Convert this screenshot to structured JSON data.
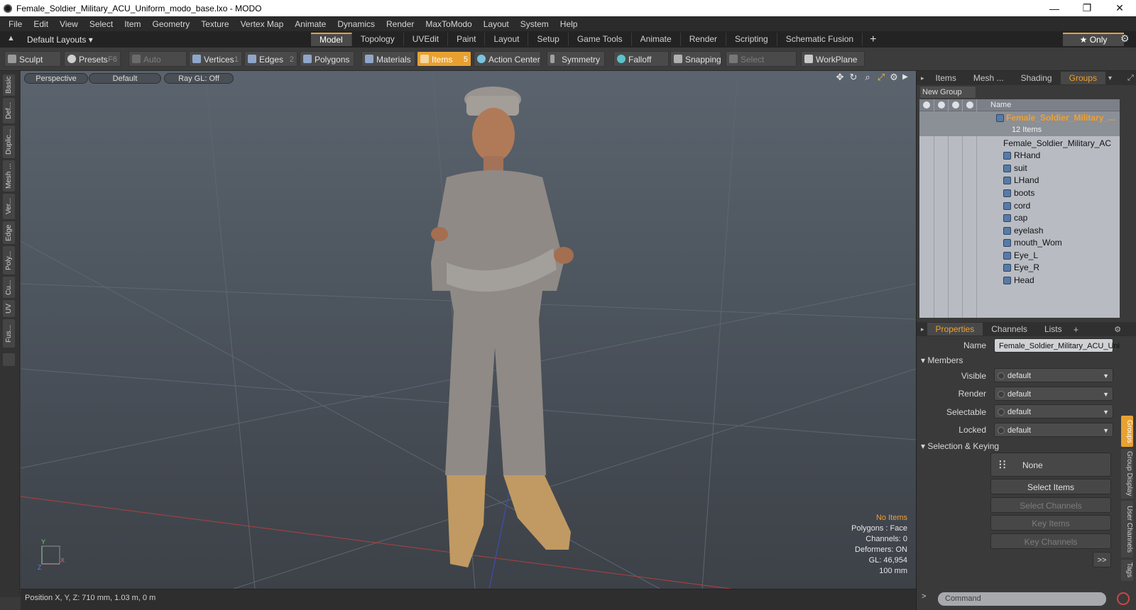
{
  "window": {
    "title": "Female_Soldier_Military_ACU_Uniform_modo_base.lxo - MODO",
    "minimize": "—",
    "maximize": "❐",
    "close": "✕"
  },
  "menu": [
    "File",
    "Edit",
    "View",
    "Select",
    "Item",
    "Geometry",
    "Texture",
    "Vertex Map",
    "Animate",
    "Dynamics",
    "Render",
    "MaxToModo",
    "Layout",
    "System",
    "Help"
  ],
  "layout_tabs": {
    "layouts_label": "Default Layouts ▾",
    "tabs": [
      "Model",
      "Topology",
      "UVEdit",
      "Paint",
      "Layout",
      "Setup",
      "Game Tools",
      "Animate",
      "Render",
      "Scripting",
      "Schematic Fusion"
    ],
    "active": "Model",
    "only_label": "★  Only"
  },
  "toolbar": {
    "sculpt": "Sculpt",
    "presets": "Presets",
    "presets_key": "F6",
    "auto_select": "Auto Select",
    "vertices": "Vertices",
    "vertices_key": "1",
    "edges": "Edges",
    "edges_key": "2",
    "polygons": "Polygons",
    "materials": "Materials",
    "items": "Items",
    "items_key": "5",
    "action_center": "Action Center",
    "symmetry": "Symmetry",
    "falloff": "Falloff",
    "snapping": "Snapping",
    "select_through": "Select Through",
    "workplane": "WorkPlane"
  },
  "left_tabs": [
    "Basic",
    "Def...",
    "Duplic...",
    "Mesh ...",
    "Ver...",
    "Edge",
    "Poly...",
    "Cu...",
    "UV",
    "Fus..."
  ],
  "viewport": {
    "perspective": "Perspective",
    "shading": "Default",
    "raygl": "Ray GL: Off",
    "info": {
      "no_items": "No Items",
      "polygons": "Polygons : Face",
      "channels": "Channels: 0",
      "deformers": "Deformers: ON",
      "gl": "GL: 46,954",
      "scale": "100 mm"
    },
    "axis_y": "Y",
    "axis_x": "X",
    "axis_z": "Z"
  },
  "status": {
    "position": "Position X, Y, Z:   710 mm, 1.03 m, 0 m"
  },
  "scene_panel": {
    "tabs": [
      "Items",
      "Mesh ...",
      "Shading",
      "Groups"
    ],
    "active": "Groups",
    "new_group": "New Group",
    "col_name": "Name",
    "group_name": "Female_Soldier_Military_...",
    "group_count": "12 Items",
    "items": [
      "Female_Soldier_Military_AC ...",
      "RHand",
      "suit",
      "LHand",
      "boots",
      "cord",
      "cap",
      "eyelash",
      "mouth_Wom",
      "Eye_L",
      "Eye_R",
      "Head"
    ]
  },
  "properties": {
    "tabs": [
      "Properties",
      "Channels",
      "Lists"
    ],
    "active": "Properties",
    "name_label": "Name",
    "name_value": "Female_Soldier_Military_ACU_Uni",
    "members_section": "Members",
    "fields": [
      {
        "label": "Visible",
        "value": "default"
      },
      {
        "label": "Render",
        "value": "default"
      },
      {
        "label": "Selectable",
        "value": "default"
      },
      {
        "label": "Locked",
        "value": "default"
      }
    ],
    "keying_section": "Selection & Keying",
    "none_label": "None",
    "buttons": [
      "Select Items",
      "Select Channels",
      "Key Items",
      "Key Channels"
    ],
    "more": ">>",
    "side_tabs": [
      "Groups",
      "Group Display",
      "User Channels",
      "Tags"
    ],
    "command_placeholder": "Command"
  }
}
